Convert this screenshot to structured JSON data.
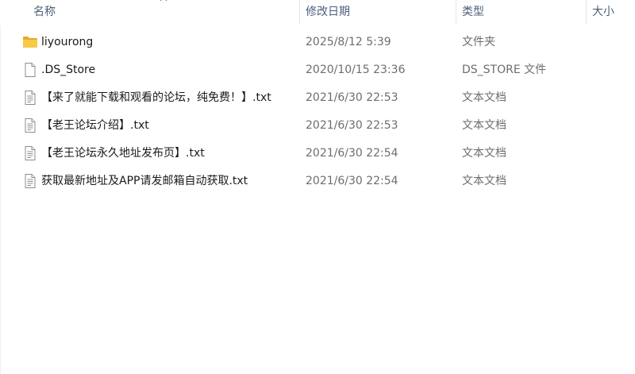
{
  "columns": {
    "name": "名称",
    "date_modified": "修改日期",
    "type": "类型",
    "size": "大小"
  },
  "sort": {
    "column": "name",
    "icon": "chevron-up-icon"
  },
  "files": [
    {
      "name": "liyourong",
      "date": "2025/8/12 5:39",
      "type": "文件夹",
      "size": "",
      "icon": "folder-icon"
    },
    {
      "name": ".DS_Store",
      "date": "2020/10/15 23:36",
      "type": "DS_STORE 文件",
      "size": "",
      "icon": "blank-file-icon"
    },
    {
      "name": "【来了就能下载和观看的论坛，纯免费！】.txt",
      "date": "2021/6/30 22:53",
      "type": "文本文档",
      "size": "",
      "icon": "text-file-icon"
    },
    {
      "name": "【老王论坛介绍】.txt",
      "date": "2021/6/30 22:53",
      "type": "文本文档",
      "size": "",
      "icon": "text-file-icon"
    },
    {
      "name": "【老王论坛永久地址发布页】.txt",
      "date": "2021/6/30 22:54",
      "type": "文本文档",
      "size": "",
      "icon": "text-file-icon"
    },
    {
      "name": "获取最新地址及APP请发邮箱自动获取.txt",
      "date": "2021/6/30 22:54",
      "type": "文本文档",
      "size": "",
      "icon": "text-file-icon"
    }
  ],
  "colors": {
    "header_text": "#4c607a",
    "secondary_text": "#6d6d6d",
    "folder": "#f7c948"
  }
}
